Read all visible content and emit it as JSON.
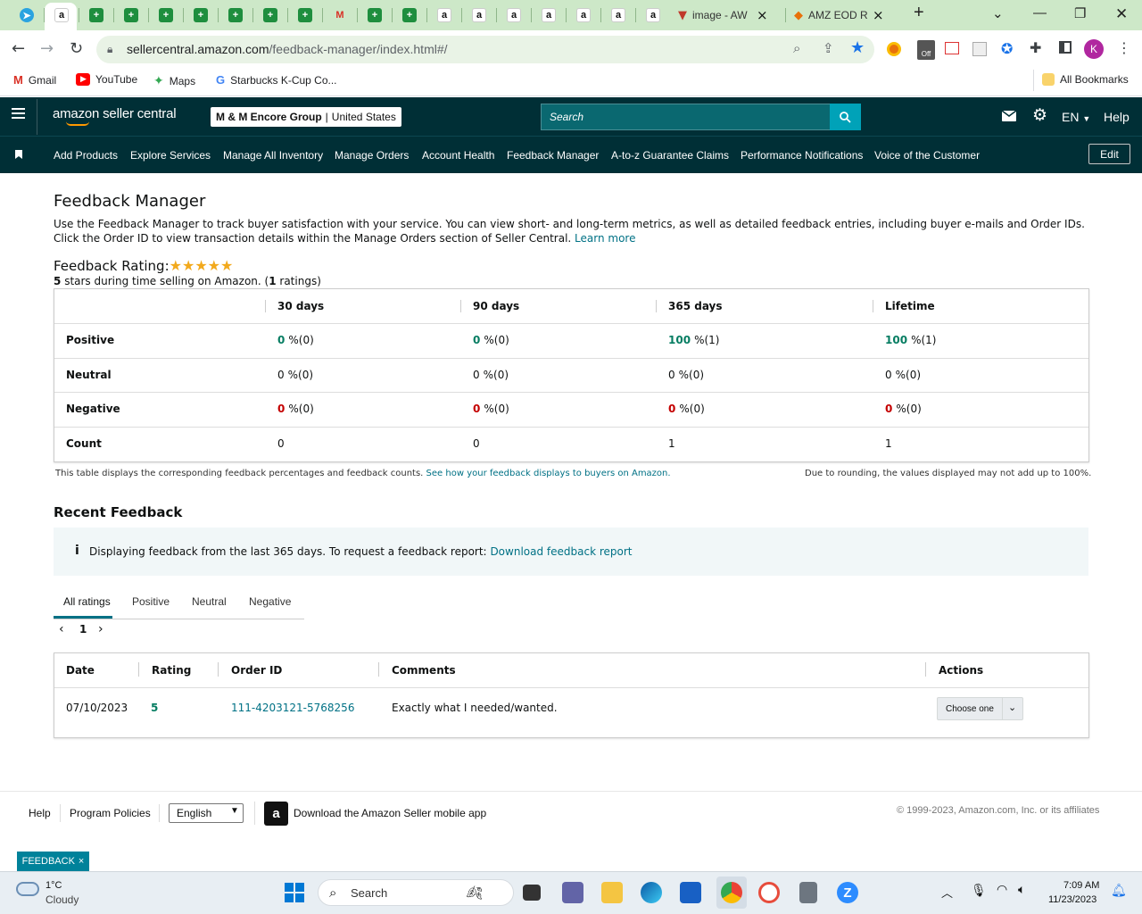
{
  "browser": {
    "tabs": [
      {
        "icon": "telegram-icon"
      },
      {
        "icon": "amazon-icon",
        "active": true
      },
      {
        "icon": "green-plus-icon"
      },
      {
        "icon": "green-plus-icon"
      },
      {
        "icon": "green-plus-icon"
      },
      {
        "icon": "green-plus-icon"
      },
      {
        "icon": "green-plus-icon"
      },
      {
        "icon": "green-plus-icon"
      },
      {
        "icon": "green-plus-icon"
      },
      {
        "icon": "gmail-icon"
      },
      {
        "icon": "green-plus-icon"
      },
      {
        "icon": "green-plus-icon"
      },
      {
        "icon": "amazon-icon"
      },
      {
        "icon": "amazon-icon"
      },
      {
        "icon": "amazon-icon"
      },
      {
        "icon": "amazon-icon"
      },
      {
        "icon": "amazon-icon"
      },
      {
        "icon": "amazon-icon"
      },
      {
        "icon": "amazon-icon"
      }
    ],
    "named_tabs": [
      {
        "title": "image - AW",
        "close": "×"
      },
      {
        "title": "AMZ EOD R",
        "close": "×"
      }
    ],
    "new_tab": "+",
    "url_domain": "sellercentral.amazon.com",
    "url_path": "/feedback-manager/index.html#/",
    "bookmarks": [
      {
        "label": "Gmail"
      },
      {
        "label": "YouTube"
      },
      {
        "label": "Maps"
      },
      {
        "label": "Starbucks K-Cup Co..."
      }
    ],
    "all_bookmarks": "All Bookmarks",
    "profile_initial": "K",
    "ext_off_badge": "Off"
  },
  "header": {
    "logo": "amazon seller central",
    "store_name": "M & M Encore Group",
    "store_region": "United States",
    "search_placeholder": "Search",
    "language": "EN",
    "help": "Help"
  },
  "nav": {
    "items": [
      "Add Products",
      "Explore Services",
      "Manage All Inventory",
      "Manage Orders",
      "Account Health",
      "Feedback Manager",
      "A-to-z Guarantee Claims",
      "Performance Notifications",
      "Voice of the Customer"
    ],
    "edit": "Edit"
  },
  "page": {
    "title": "Feedback Manager",
    "description_1": "Use the Feedback Manager to track buyer satisfaction with your service. You can view short- and long-term metrics, as well as detailed feedback entries, including buyer e-mails and Order IDs.",
    "description_2": "Click the Order ID to view transaction details within the Manage Orders section of Seller Central.",
    "learn_more": "Learn more",
    "rating_title": "Feedback Rating:",
    "rating_stars": 5,
    "rating_sub_value": "5",
    "rating_sub_text": "stars during time selling on Amazon. (",
    "rating_count": "1",
    "rating_sub_end": "ratings)"
  },
  "ratings_table": {
    "columns": [
      "30 days",
      "90 days",
      "365 days",
      "Lifetime"
    ],
    "rows": [
      {
        "label": "Positive",
        "cells": [
          [
            "0",
            "%(0)"
          ],
          [
            "0",
            "%(0)"
          ],
          [
            "100",
            "%(1)"
          ],
          [
            "100",
            "%(1)"
          ]
        ]
      },
      {
        "label": "Neutral",
        "cells": [
          [
            "0",
            "%(0)"
          ],
          [
            "0",
            "%(0)"
          ],
          [
            "0",
            "%(0)"
          ],
          [
            "0",
            "%(0)"
          ]
        ]
      },
      {
        "label": "Negative",
        "cells": [
          [
            "0",
            "%(0)"
          ],
          [
            "0",
            "%(0)"
          ],
          [
            "0",
            "%(0)"
          ],
          [
            "0",
            "%(0)"
          ]
        ]
      },
      {
        "label": "Count",
        "cells": [
          [
            "0",
            ""
          ],
          [
            "0",
            ""
          ],
          [
            "1",
            ""
          ],
          [
            "1",
            ""
          ]
        ]
      }
    ],
    "note_left": "This table displays the corresponding feedback percentages and feedback counts.",
    "note_link": "See how your feedback displays to buyers on Amazon.",
    "note_right": "Due to rounding, the values displayed may not add up to 100%."
  },
  "recent": {
    "title": "Recent Feedback",
    "info_text": "Displaying feedback from the last 365 days. To request a feedback report:",
    "info_link": "Download feedback report",
    "filter_tabs": [
      "All ratings",
      "Positive",
      "Neutral",
      "Negative"
    ],
    "page": "1",
    "columns": [
      "Date",
      "Rating",
      "Order ID",
      "Comments",
      "Actions"
    ],
    "rows": [
      {
        "date": "07/10/2023",
        "rating": "5",
        "order_id": "111-4203121-5768256",
        "comment": "Exactly what I needed/wanted.",
        "action": "Choose one"
      }
    ]
  },
  "footer": {
    "help": "Help",
    "policies": "Program Policies",
    "language": "English",
    "app": "Download the Amazon Seller mobile app",
    "copyright": "© 1999-2023, Amazon.com, Inc. or its affiliates",
    "feedback_tab": "FEEDBACK"
  },
  "taskbar": {
    "weather_temp": "1°C",
    "weather_desc": "Cloudy",
    "search": "Search",
    "time": "7:09 AM",
    "date": "11/23/2023"
  }
}
